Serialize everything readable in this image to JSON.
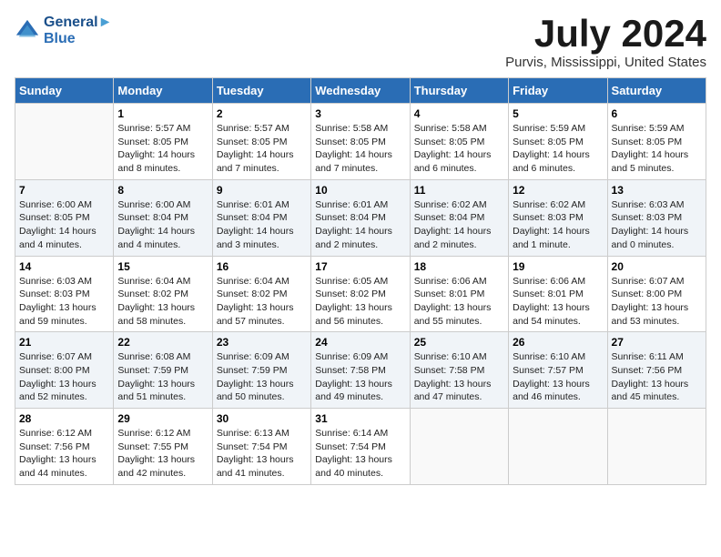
{
  "header": {
    "logo_line1": "General",
    "logo_line2": "Blue",
    "month_title": "July 2024",
    "location": "Purvis, Mississippi, United States"
  },
  "weekdays": [
    "Sunday",
    "Monday",
    "Tuesday",
    "Wednesday",
    "Thursday",
    "Friday",
    "Saturday"
  ],
  "weeks": [
    [
      {
        "day": "",
        "info": ""
      },
      {
        "day": "1",
        "info": "Sunrise: 5:57 AM\nSunset: 8:05 PM\nDaylight: 14 hours\nand 8 minutes."
      },
      {
        "day": "2",
        "info": "Sunrise: 5:57 AM\nSunset: 8:05 PM\nDaylight: 14 hours\nand 7 minutes."
      },
      {
        "day": "3",
        "info": "Sunrise: 5:58 AM\nSunset: 8:05 PM\nDaylight: 14 hours\nand 7 minutes."
      },
      {
        "day": "4",
        "info": "Sunrise: 5:58 AM\nSunset: 8:05 PM\nDaylight: 14 hours\nand 6 minutes."
      },
      {
        "day": "5",
        "info": "Sunrise: 5:59 AM\nSunset: 8:05 PM\nDaylight: 14 hours\nand 6 minutes."
      },
      {
        "day": "6",
        "info": "Sunrise: 5:59 AM\nSunset: 8:05 PM\nDaylight: 14 hours\nand 5 minutes."
      }
    ],
    [
      {
        "day": "7",
        "info": "Sunrise: 6:00 AM\nSunset: 8:05 PM\nDaylight: 14 hours\nand 4 minutes."
      },
      {
        "day": "8",
        "info": "Sunrise: 6:00 AM\nSunset: 8:04 PM\nDaylight: 14 hours\nand 4 minutes."
      },
      {
        "day": "9",
        "info": "Sunrise: 6:01 AM\nSunset: 8:04 PM\nDaylight: 14 hours\nand 3 minutes."
      },
      {
        "day": "10",
        "info": "Sunrise: 6:01 AM\nSunset: 8:04 PM\nDaylight: 14 hours\nand 2 minutes."
      },
      {
        "day": "11",
        "info": "Sunrise: 6:02 AM\nSunset: 8:04 PM\nDaylight: 14 hours\nand 2 minutes."
      },
      {
        "day": "12",
        "info": "Sunrise: 6:02 AM\nSunset: 8:03 PM\nDaylight: 14 hours\nand 1 minute."
      },
      {
        "day": "13",
        "info": "Sunrise: 6:03 AM\nSunset: 8:03 PM\nDaylight: 14 hours\nand 0 minutes."
      }
    ],
    [
      {
        "day": "14",
        "info": "Sunrise: 6:03 AM\nSunset: 8:03 PM\nDaylight: 13 hours\nand 59 minutes."
      },
      {
        "day": "15",
        "info": "Sunrise: 6:04 AM\nSunset: 8:02 PM\nDaylight: 13 hours\nand 58 minutes."
      },
      {
        "day": "16",
        "info": "Sunrise: 6:04 AM\nSunset: 8:02 PM\nDaylight: 13 hours\nand 57 minutes."
      },
      {
        "day": "17",
        "info": "Sunrise: 6:05 AM\nSunset: 8:02 PM\nDaylight: 13 hours\nand 56 minutes."
      },
      {
        "day": "18",
        "info": "Sunrise: 6:06 AM\nSunset: 8:01 PM\nDaylight: 13 hours\nand 55 minutes."
      },
      {
        "day": "19",
        "info": "Sunrise: 6:06 AM\nSunset: 8:01 PM\nDaylight: 13 hours\nand 54 minutes."
      },
      {
        "day": "20",
        "info": "Sunrise: 6:07 AM\nSunset: 8:00 PM\nDaylight: 13 hours\nand 53 minutes."
      }
    ],
    [
      {
        "day": "21",
        "info": "Sunrise: 6:07 AM\nSunset: 8:00 PM\nDaylight: 13 hours\nand 52 minutes."
      },
      {
        "day": "22",
        "info": "Sunrise: 6:08 AM\nSunset: 7:59 PM\nDaylight: 13 hours\nand 51 minutes."
      },
      {
        "day": "23",
        "info": "Sunrise: 6:09 AM\nSunset: 7:59 PM\nDaylight: 13 hours\nand 50 minutes."
      },
      {
        "day": "24",
        "info": "Sunrise: 6:09 AM\nSunset: 7:58 PM\nDaylight: 13 hours\nand 49 minutes."
      },
      {
        "day": "25",
        "info": "Sunrise: 6:10 AM\nSunset: 7:58 PM\nDaylight: 13 hours\nand 47 minutes."
      },
      {
        "day": "26",
        "info": "Sunrise: 6:10 AM\nSunset: 7:57 PM\nDaylight: 13 hours\nand 46 minutes."
      },
      {
        "day": "27",
        "info": "Sunrise: 6:11 AM\nSunset: 7:56 PM\nDaylight: 13 hours\nand 45 minutes."
      }
    ],
    [
      {
        "day": "28",
        "info": "Sunrise: 6:12 AM\nSunset: 7:56 PM\nDaylight: 13 hours\nand 44 minutes."
      },
      {
        "day": "29",
        "info": "Sunrise: 6:12 AM\nSunset: 7:55 PM\nDaylight: 13 hours\nand 42 minutes."
      },
      {
        "day": "30",
        "info": "Sunrise: 6:13 AM\nSunset: 7:54 PM\nDaylight: 13 hours\nand 41 minutes."
      },
      {
        "day": "31",
        "info": "Sunrise: 6:14 AM\nSunset: 7:54 PM\nDaylight: 13 hours\nand 40 minutes."
      },
      {
        "day": "",
        "info": ""
      },
      {
        "day": "",
        "info": ""
      },
      {
        "day": "",
        "info": ""
      }
    ]
  ]
}
